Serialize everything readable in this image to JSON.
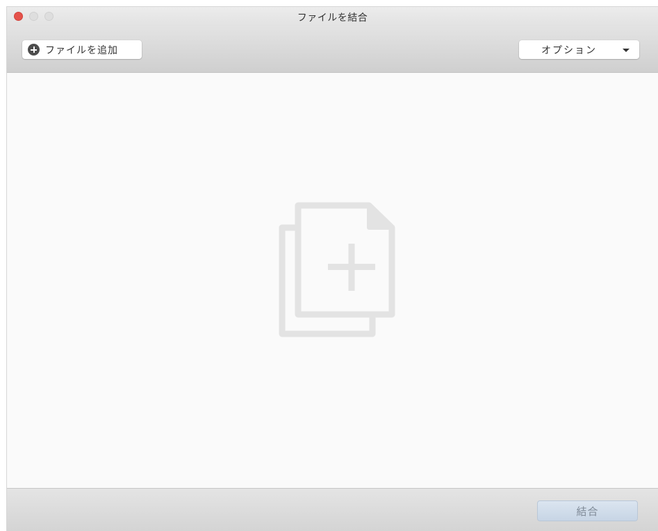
{
  "window": {
    "title": "ファイルを結合"
  },
  "toolbar": {
    "add_files_label": "ファイルを追加",
    "options_label": "オプション"
  },
  "footer": {
    "combine_label": "結合",
    "combine_enabled": false
  },
  "colors": {
    "close_button": "#e5534b",
    "combine_button_bg": "#c7d5e5",
    "combine_button_text": "#7f8a97"
  }
}
